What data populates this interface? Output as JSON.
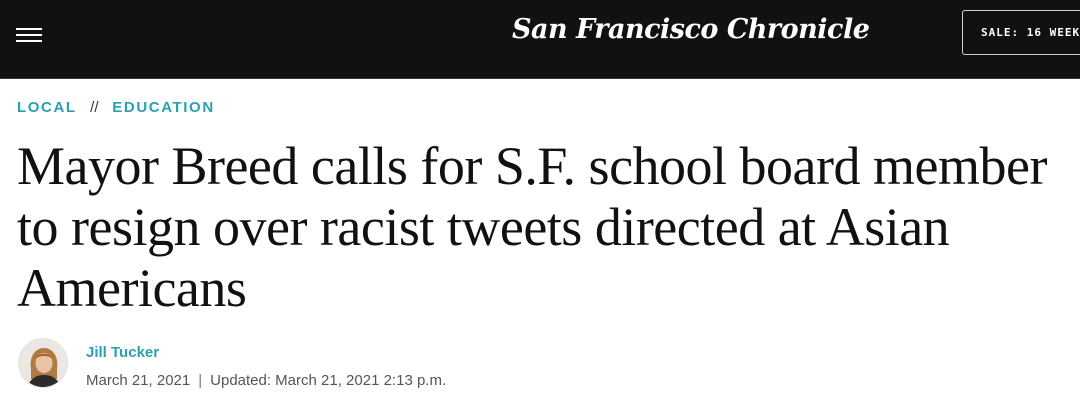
{
  "header": {
    "logo_text": "San Francisco Chronicle",
    "menu_icon": "hamburger-menu-icon",
    "sale_label": "SALE: 16 WEEK"
  },
  "breadcrumb": {
    "section": "LOCAL",
    "separator": "//",
    "subsection": "EDUCATION",
    "accent_color": "#2aa1ad"
  },
  "article": {
    "headline": "Mayor Breed calls for S.F. school board member to resign over racist tweets directed at Asian Americans",
    "author": "Jill Tucker",
    "published": "March 21, 2021",
    "divider": "|",
    "updated": "Updated: March 21, 2021 2:13 p.m."
  }
}
